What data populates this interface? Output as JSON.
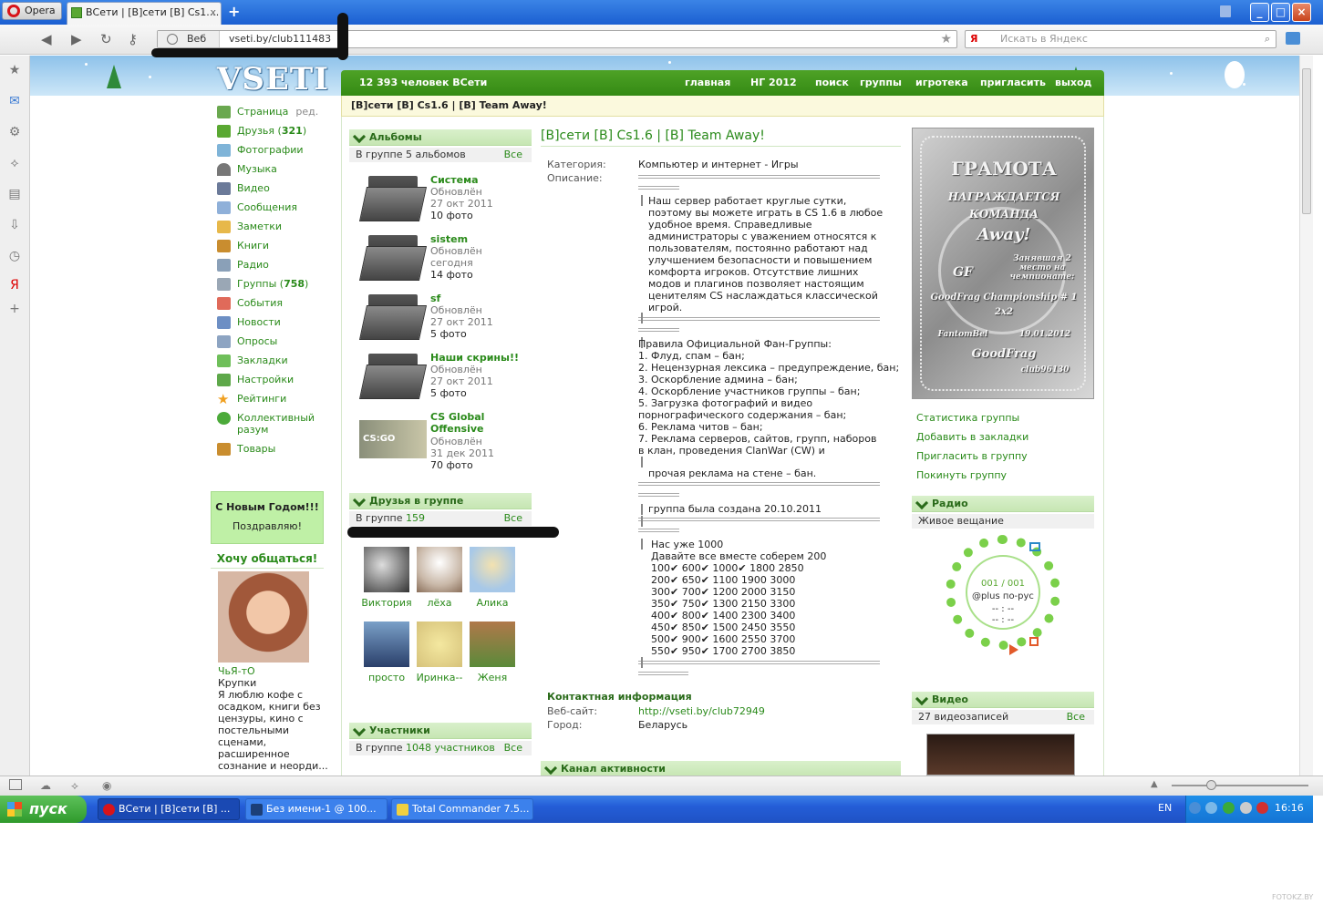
{
  "browser": {
    "opera_label": "Opera",
    "tab_title": "ВСети | [В]сети [В] Cs1....",
    "tab_close": "x",
    "new_tab": "+",
    "web_label": "Веб",
    "url": "vseti.by/club111483",
    "search_engine": "Я",
    "search_placeholder": "Искать в Яндекс"
  },
  "site": {
    "logo": "VSETI",
    "online_count": "12 393 человек ВСети",
    "nav": [
      "главная",
      "НГ 2012",
      "поиск",
      "группы",
      "игротека",
      "пригласить",
      "выход"
    ],
    "group_bar": "[В]сети [В] Cs1.6 | [В] Team Away!",
    "colors": {
      "green": "#348a14",
      "link": "#2a8a1a",
      "section_bg": "#d9f0cb",
      "highlight": "#bff0a6"
    }
  },
  "menu": [
    {
      "label": "Страница",
      "extra": "ред.",
      "icon": "home-icon"
    },
    {
      "label": "Друзья",
      "count": "321",
      "icon": "friends-icon"
    },
    {
      "label": "Фотографии",
      "icon": "photo-icon"
    },
    {
      "label": "Музыка",
      "icon": "headphones-icon"
    },
    {
      "label": "Видео",
      "icon": "film-icon"
    },
    {
      "label": "Сообщения",
      "icon": "messages-icon"
    },
    {
      "label": "Заметки",
      "icon": "pencil-icon"
    },
    {
      "label": "Книги",
      "icon": "book-icon"
    },
    {
      "label": "Радио",
      "icon": "radio-icon"
    },
    {
      "label": "Группы",
      "count": "758",
      "icon": "groups-icon"
    },
    {
      "label": "События",
      "icon": "calendar-icon"
    },
    {
      "label": "Новости",
      "icon": "news-icon"
    },
    {
      "label": "Опросы",
      "icon": "poll-icon"
    },
    {
      "label": "Закладки",
      "icon": "bookmark-icon"
    },
    {
      "label": "Настройки",
      "icon": "settings-icon"
    },
    {
      "label": "Рейтинги",
      "icon": "star-icon"
    },
    {
      "label": "Коллективный разум",
      "icon": "question-icon"
    },
    {
      "label": "Товары",
      "icon": "goods-icon"
    }
  ],
  "ny_box": {
    "line1": "С Новым Годом!!!",
    "line2": "Поздравляю!"
  },
  "chat": {
    "title": "Хочу общаться!",
    "name": "ЧьЯ-тО",
    "sub": "Крупки",
    "text": "Я люблю кофе с\nосадком, книги без\nцензуры, кино с\nпостельными\nсценами,\nрасширенное\nсознание и неорди..."
  },
  "albums": {
    "title": "Альбомы",
    "summary": "В группе 5 альбомов",
    "all": "Все",
    "items": [
      {
        "name": "Система",
        "status": "Обновлён",
        "date": "27 окт 2011",
        "count": "10 фото"
      },
      {
        "name": "sistem",
        "status": "Обновлён",
        "date": "сегодня",
        "count": "14 фото"
      },
      {
        "name": "sf",
        "status": "Обновлён",
        "date": "27 окт 2011",
        "count": "5 фото"
      },
      {
        "name": "Наши скрины!!",
        "status": "Обновлён",
        "date": "27 окт 2011",
        "count": "5 фото"
      },
      {
        "name": "CS Global Offensive",
        "status": "Обновлён",
        "date": "31 дек 2011",
        "count": "70 фото"
      }
    ],
    "thumb_text": "CS:GO"
  },
  "friends": {
    "title": "Друзья в группе",
    "summary_prefix": "В группе",
    "summary_count": "159",
    "all": "Все",
    "items": [
      "Виктория",
      "лёха",
      "Алика",
      "просто",
      "Иринка--",
      "Женя"
    ]
  },
  "members": {
    "title": "Участники",
    "summary_prefix": "В группе",
    "summary_count": "1048 участников",
    "all": "Все"
  },
  "group": {
    "title": "[В]сети [В] Cs1.6 | [В] Team Away!",
    "category_label": "Категория:",
    "category": "Компьютер и интернет - Игры",
    "desc_label": "Описание:",
    "desc1": "Наш сервер работает круглые сутки,\nпоэтому вы можете играть в CS 1.6 в любое\nудобное время. Справедливые\nадминистраторы с уважением относятся к\nпользователям, постоянно работают над\nулучшением безопасности и повышением\nкомфорта игроков. Отсутствие лишних\nмодов и плагинов позволяет настоящим\nценителям CS наслаждаться классической\nигрой.",
    "rules": "Правила Официальной Фан-Группы:\n1. Флуд, спам – бан;\n2. Нецензурная лексика – предупреждение, бан;\n3. Оскорбление админа – бан;\n4. Оскорбление участников группы – бан;\n5. Загрузка фотографий и видео\nпорнографического содержания – бан;\n6. Реклама читов – бан;\n7. Реклама серверов, сайтов, групп, наборов\nв клан, проведения ClanWar (CW) и",
    "rules2": "прочая реклама на стене – бан.",
    "created": "группа была создана 20.10.2011",
    "goals": "Нас уже 1000\nДавайте все вместе соберем 200\n100✔ 600✔ 1000✔ 1800 2850\n200✔ 650✔ 1100 1900 3000\n300✔ 700✔ 1200 2000 3150\n350✔ 750✔ 1300 2150 3300\n400✔ 800✔ 1400 2300 3400\n450✔ 850✔ 1500 2450 3550\n500✔ 900✔ 1600 2550 3700\n550✔ 950✔ 1700 2700 3850",
    "contact_title": "Контактная информация",
    "site_label": "Веб-сайт:",
    "site": "http://vseti.by/club72949",
    "city_label": "Город:",
    "city": "Беларусь",
    "activity_title": "Канал активности"
  },
  "gramota": {
    "title": "ГРАМОТА",
    "l1": "НАГРАЖДАЕТСЯ",
    "l2": "КОМАНДА",
    "l3": "Away!",
    "l4": "Занявшая 2 место на чемпионате:",
    "gf": "GF",
    "l5": "GoodFrag Championship # 1",
    "l6": "2x2",
    "l7": "FantomBel",
    "l8": "19.01.2012",
    "l9": "GoodFrag",
    "l10": "club96130"
  },
  "right_links": [
    "Статистика группы",
    "Добавить в закладки",
    "Пригласить в группу",
    "Покинуть группу"
  ],
  "radio": {
    "title": "Радио",
    "sub": "Живое вещание",
    "counter": "001 / 001",
    "station": "@plus по-рус",
    "time1": "-- : --",
    "time2": "-- : --"
  },
  "video": {
    "title": "Видео",
    "summary": "27 видеозаписей",
    "all": "Все"
  },
  "taskbar": {
    "start": "пуск",
    "items": [
      "ВСети | [В]сети [В] ...",
      "Без имени-1 @ 100...",
      "Total Commander 7.5..."
    ],
    "lang": "EN",
    "clock": "16:16"
  },
  "watermark": "FOTOKZ.BY"
}
